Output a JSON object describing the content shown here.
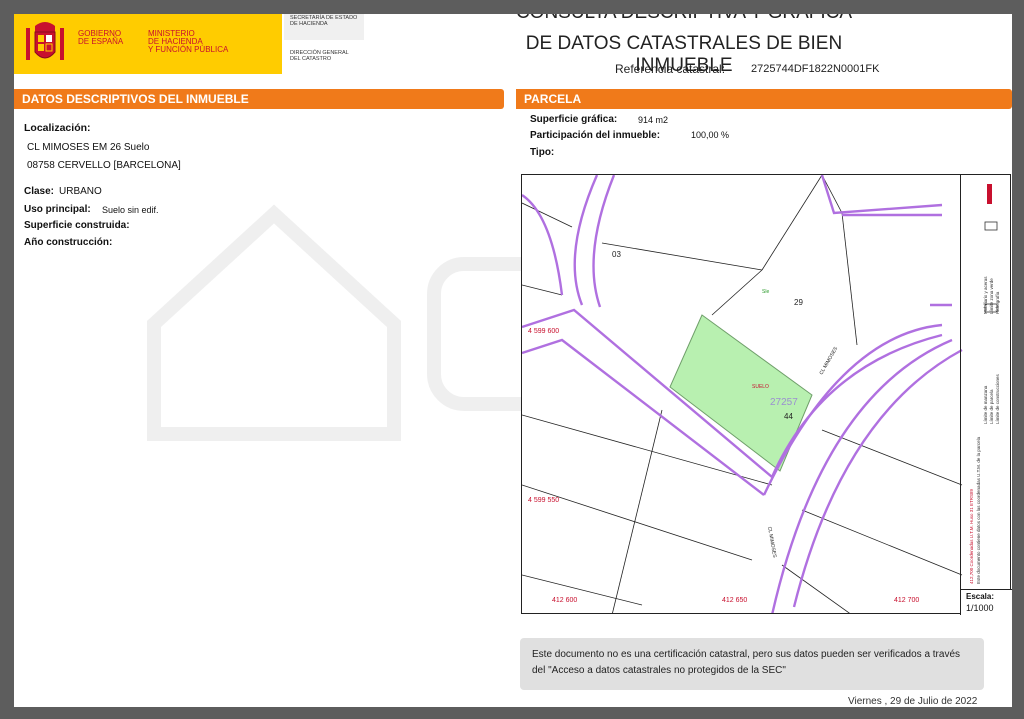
{
  "header": {
    "gov_line1": "GOBIERNO",
    "gov_line2": "DE ESPAÑA",
    "ministry_line1": "MINISTERIO",
    "ministry_line2": "DE HACIENDA",
    "ministry_line3": "Y FUNCIÓN PÚBLICA",
    "secretaria_line1": "SECRETARÍA DE ESTADO",
    "secretaria_line2": "DE HACIENDA",
    "direccion_line1": "DIRECCIÓN GENERAL",
    "direccion_line2": "DEL CATASTRO",
    "title_line1": "CONSULTA DESCRIPTIVA Y GRÁFICA",
    "title_line2": "DE DATOS CATASTRALES DE BIEN INMUEBLE",
    "ref_label": "Referencia catastral:",
    "ref_value": "2725744DF1822N0001FK"
  },
  "left": {
    "bar_title": "DATOS DESCRIPTIVOS DEL INMUEBLE",
    "localizacion_label": "Localización:",
    "address_line1": "CL MIMOSES EM 26 Suelo",
    "address_line2": "08758 CERVELLO [BARCELONA]",
    "clase_label": "Clase:",
    "clase_value": "URBANO",
    "uso_label": "Uso principal:",
    "uso_value": "Suelo sin edif.",
    "superficie_label": "Superficie construida:",
    "ano_label": "Año construcción:"
  },
  "right": {
    "bar_title": "PARCELA",
    "superficie_label": "Superficie gráfica:",
    "superficie_value": "914 m2",
    "participacion_label": "Participación del inmueble:",
    "participacion_value": "100,00 %",
    "tipo_label": "Tipo:"
  },
  "map": {
    "label_03": "03",
    "label_29": "29",
    "label_27257": "27257",
    "label_44": "44",
    "label_suelo": "SUELO",
    "label_s": "Sle",
    "coord_y1": "4 599 600",
    "coord_y2": "4 599 550",
    "coord_x1": "412 600",
    "coord_x2": "412 650",
    "coord_x3": "412 700",
    "street_1": "CL MIMOSES",
    "street_2": "CL MIMOSES",
    "legend_1": "Límite de manzana",
    "legend_2": "Límite de parcela",
    "legend_3": "Límite de construcciones",
    "legend_4": "Mobiliario y aceras",
    "legend_5": "Límite zona verde",
    "legend_6": "Hidrografía",
    "legend_coords": "412,700 Coordenadas U.T.M. Huso 31 ETRS89",
    "legend_note": "Este documento contiene datos con las coordenadas U.T.M. de la parcela",
    "scale_label": "Escala:",
    "scale_value": "1/1000"
  },
  "notice": {
    "text": "Este documento no es una certificación catastral, pero sus datos pueden ser verificados a través del \"Acceso a datos catastrales no protegidos de la SEC\""
  },
  "footer": {
    "date": "Viernes , 29 de Julio de 2022"
  },
  "colors": {
    "orange": "#f07a1a",
    "yellow": "#ffcc00",
    "red": "#c8102e",
    "parcel_fill": "#b8f0b0",
    "street_line": "#b070e0"
  }
}
